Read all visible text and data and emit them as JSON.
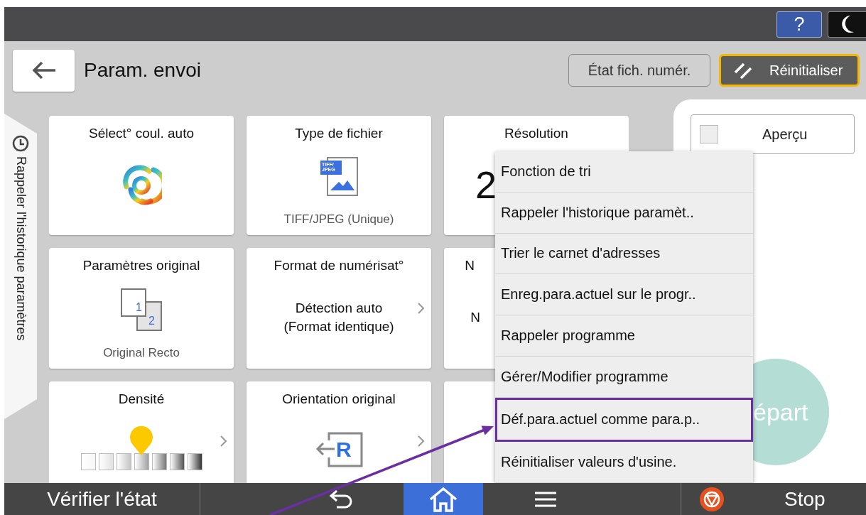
{
  "top_bar": {
    "help_label": "?"
  },
  "header": {
    "title": "Param. envoi",
    "buttons": [
      {
        "label": "État fich. numér.",
        "kind": "plain",
        "focused": false
      },
      {
        "label": "Réinitialiser",
        "kind": "reset",
        "focused": true
      }
    ]
  },
  "side_tab": {
    "label": "Rappeler l'historique paramètres"
  },
  "cards": [
    {
      "kind": "swirl",
      "title": "Sélect° coul. auto",
      "chevron": false
    },
    {
      "kind": "filetype",
      "title": "Type de fichier",
      "icon_lines": [
        "TIFF/",
        "JPEG"
      ],
      "value_lines": [
        "TIFF/JPEG (Unique)"
      ],
      "chevron": false
    },
    {
      "kind": "resolution",
      "title": "Résolution",
      "value_lines": [
        "2"
      ],
      "chevron": false
    },
    {
      "kind": "pages",
      "title": "Paramètres original",
      "icon_lines": [
        "1",
        "2"
      ],
      "value_lines": [
        "Original Recto"
      ],
      "chevron": false
    },
    {
      "kind": "value",
      "title": "Format de numérisat°",
      "value_lines": [
        "Détection auto",
        "(Format identique)"
      ],
      "chevron": true
    },
    {
      "kind": "covered",
      "title": "N",
      "value_lines": [
        "N"
      ],
      "chevron": false
    },
    {
      "kind": "density",
      "title": "Densité",
      "level": 0.5,
      "chevron": true
    },
    {
      "kind": "orientation",
      "title": "Orientation original",
      "icon_lines": [
        "R"
      ],
      "chevron": true
    },
    {
      "kind": "covered",
      "chevron": false
    }
  ],
  "preview": {
    "label": "Aperçu",
    "checked": false
  },
  "start_button": {
    "label": "épart"
  },
  "menu": {
    "items": [
      {
        "label": "Fonction de tri",
        "highlighted": false
      },
      {
        "label": "Rappeler l'historique paramèt..",
        "highlighted": false
      },
      {
        "label": "Trier le carnet d'adresses",
        "highlighted": false
      },
      {
        "label": "Enreg.para.actuel sur le progr..",
        "highlighted": false
      },
      {
        "label": "Rappeler programme",
        "highlighted": false
      },
      {
        "label": "Gérer/Modifier programme",
        "highlighted": false
      },
      {
        "label": "Déf.para.actuel comme para.p..",
        "highlighted": true
      },
      {
        "label": "Réinitialiser valeurs d'usine.",
        "highlighted": false
      }
    ]
  },
  "bottom_bar": {
    "status": "Vérifier l'état",
    "nav": [
      {
        "kind": "back",
        "selected": false
      },
      {
        "kind": "home",
        "selected": true
      },
      {
        "kind": "menu",
        "selected": false
      }
    ],
    "stop_label": "Stop"
  }
}
